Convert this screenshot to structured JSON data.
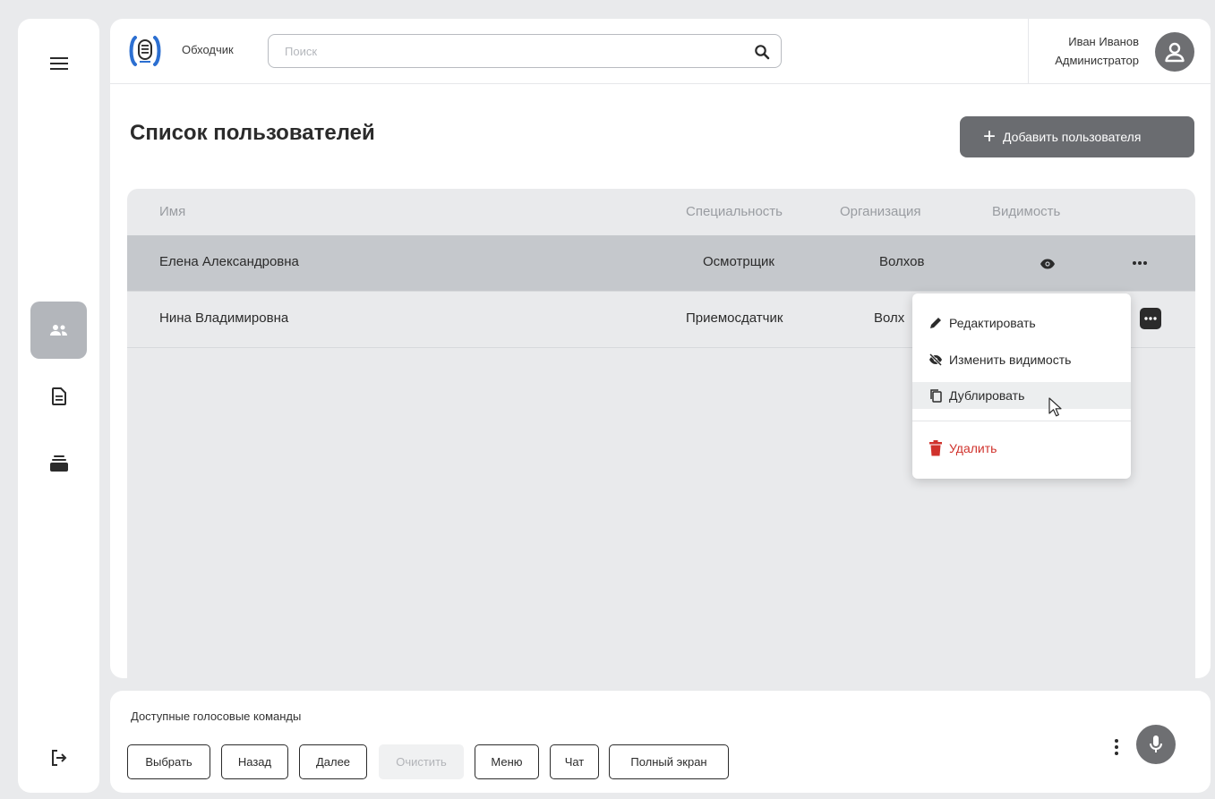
{
  "app": {
    "name": "Обходчик"
  },
  "search": {
    "placeholder": "Поиск"
  },
  "user": {
    "name": "Иван Иванов",
    "role": "Администратор"
  },
  "sidebar": {
    "items": [
      {
        "icon": "menu-icon"
      },
      {
        "icon": "users-icon",
        "active": true
      },
      {
        "icon": "document-icon"
      },
      {
        "icon": "stack-icon"
      },
      {
        "icon": "logout-icon"
      }
    ]
  },
  "page": {
    "title": "Список пользователей",
    "add_button_label": "Добавить пользователя"
  },
  "table": {
    "columns": [
      "Имя",
      "Специальность",
      "Организация",
      "Видимость"
    ],
    "rows": [
      {
        "name": "Елена Александровна",
        "specialty": "Осмотрщик",
        "organization": "Волхов",
        "visibility": "visible",
        "selected": true
      },
      {
        "name": "Нина Владимировна",
        "specialty": "Приемосдатчик",
        "organization": "Волх",
        "visibility": "",
        "selected": false
      }
    ]
  },
  "context_menu": {
    "items": [
      {
        "label": "Редактировать",
        "icon": "pencil-icon"
      },
      {
        "label": "Изменить видимость",
        "icon": "eye-off-icon"
      },
      {
        "label": "Дублировать",
        "icon": "copy-icon",
        "hovered": true
      },
      {
        "label": "Удалить",
        "icon": "trash-icon",
        "danger": true
      }
    ]
  },
  "voice": {
    "title": "Доступные голосовые команды",
    "commands": [
      {
        "label": "Выбрать",
        "enabled": true
      },
      {
        "label": "Назад",
        "enabled": true
      },
      {
        "label": "Далее",
        "enabled": true
      },
      {
        "label": "Очистить",
        "enabled": false
      },
      {
        "label": "Меню",
        "enabled": true
      },
      {
        "label": "Чат",
        "enabled": true
      },
      {
        "label": "Полный экран",
        "enabled": true
      }
    ]
  },
  "colors": {
    "background": "#e9eaec",
    "accent_gray": "#6a6c70",
    "selected_row": "#c5c8cc",
    "danger": "#d0322c",
    "logo_blue": "#2c6fd1"
  }
}
